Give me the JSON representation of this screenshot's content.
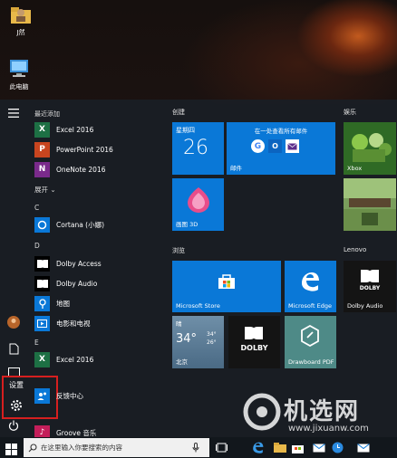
{
  "desktop": {
    "icons": [
      {
        "label": "J然",
        "icon": "user-folder-icon"
      },
      {
        "label": "此电脑",
        "icon": "computer-icon"
      }
    ]
  },
  "start_menu": {
    "recent_header": "最近添加",
    "recent": [
      {
        "label": "Excel 2016",
        "icon": "excel-icon",
        "color": "#1d7044"
      },
      {
        "label": "PowerPoint 2016",
        "icon": "powerpoint-icon",
        "color": "#c8451f"
      },
      {
        "label": "OneNote 2016",
        "icon": "onenote-icon",
        "color": "#7a2a8b"
      }
    ],
    "expand_label": "展开",
    "letters": [
      "C",
      "D",
      "E"
    ],
    "apps": [
      {
        "label": "Cortana (小娜)",
        "icon": "cortana-icon"
      },
      {
        "label": "Dolby Access",
        "icon": "dolby-icon"
      },
      {
        "label": "Dolby Audio",
        "icon": "dolby-icon"
      },
      {
        "label": "地图",
        "icon": "maps-icon"
      },
      {
        "label": "电影和电视",
        "icon": "movies-icon"
      },
      {
        "label": "Excel 2016",
        "icon": "excel-icon"
      },
      {
        "label": "反馈中心",
        "icon": "feedback-icon"
      },
      {
        "label": "Groove 音乐",
        "icon": "groove-icon"
      }
    ],
    "settings_label": "设置"
  },
  "tiles": {
    "groups": [
      "创建",
      "娱乐",
      "浏览",
      "Lenovo"
    ],
    "calendar": {
      "weekday": "星期四",
      "day": "26"
    },
    "mail": {
      "header": "在一处查看所有邮件",
      "label": "邮件"
    },
    "paint3d": "画图 3D",
    "xbox": "Xbox",
    "store": "Microsoft Store",
    "edge": "Microsoft Edge",
    "dolby_audio": "Dolby Audio",
    "weather": {
      "condition": "晴",
      "temp": "34°",
      "high": "34°",
      "low": "26°",
      "city": "北京"
    },
    "dolby": "DOLBY",
    "drawboard": "Drawboard PDF"
  },
  "taskbar": {
    "search_placeholder": "在这里输入你要搜索的内容"
  },
  "watermark": {
    "text": "机选网",
    "url": "www.jixuanw.com"
  },
  "colors": {
    "tile_blue": "#0a78d7",
    "highlight_red": "#d61f1f",
    "menu_bg": "#1a1e24"
  }
}
